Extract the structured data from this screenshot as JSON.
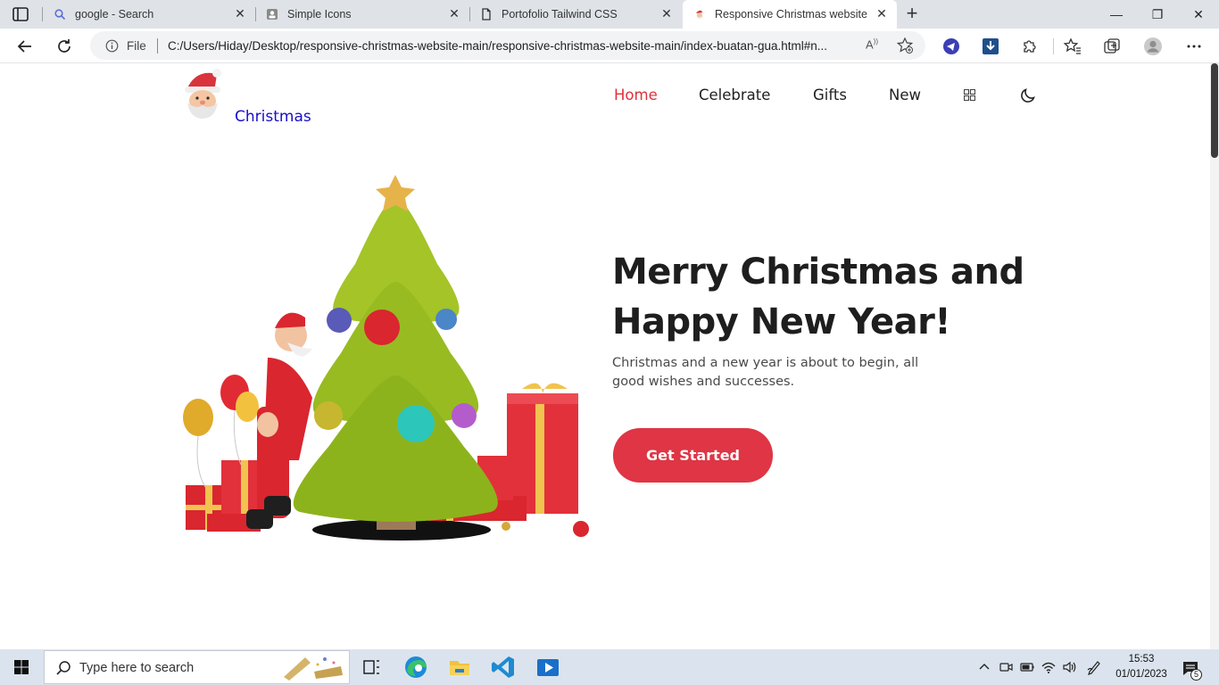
{
  "browser": {
    "tabs": [
      {
        "title": "google - Search",
        "icon": "search-icon",
        "active": false
      },
      {
        "title": "Simple Icons",
        "icon": "simple-icons-favicon",
        "active": false
      },
      {
        "title": "Portofolio Tailwind CSS",
        "icon": "page-icon",
        "active": false
      },
      {
        "title": "Responsive Christmas website",
        "icon": "santa-favicon",
        "active": true
      }
    ],
    "address": {
      "scheme_label": "File",
      "url": "C:/Users/Hiday/Desktop/responsive-christmas-website-main/responsive-christmas-website-main/index-buatan-gua.html#n..."
    }
  },
  "site": {
    "logo_text": "Christmas",
    "nav": [
      {
        "label": "Home",
        "active": true
      },
      {
        "label": "Celebrate",
        "active": false
      },
      {
        "label": "Gifts",
        "active": false
      },
      {
        "label": "New",
        "active": false
      }
    ],
    "hero": {
      "title_line1": "Merry Christmas and",
      "title_line2": "Happy New Year!",
      "subtitle": "Christmas and a new year is about to begin, all good wishes and successes.",
      "cta_label": "Get Started"
    },
    "colors": {
      "accent": "#df3545",
      "logo_link": "#1a0dcc",
      "text": "#1e1e1e"
    }
  },
  "taskbar": {
    "search_placeholder": "Type here to search",
    "time": "15:53",
    "date": "01/01/2023",
    "notification_count": "5"
  }
}
